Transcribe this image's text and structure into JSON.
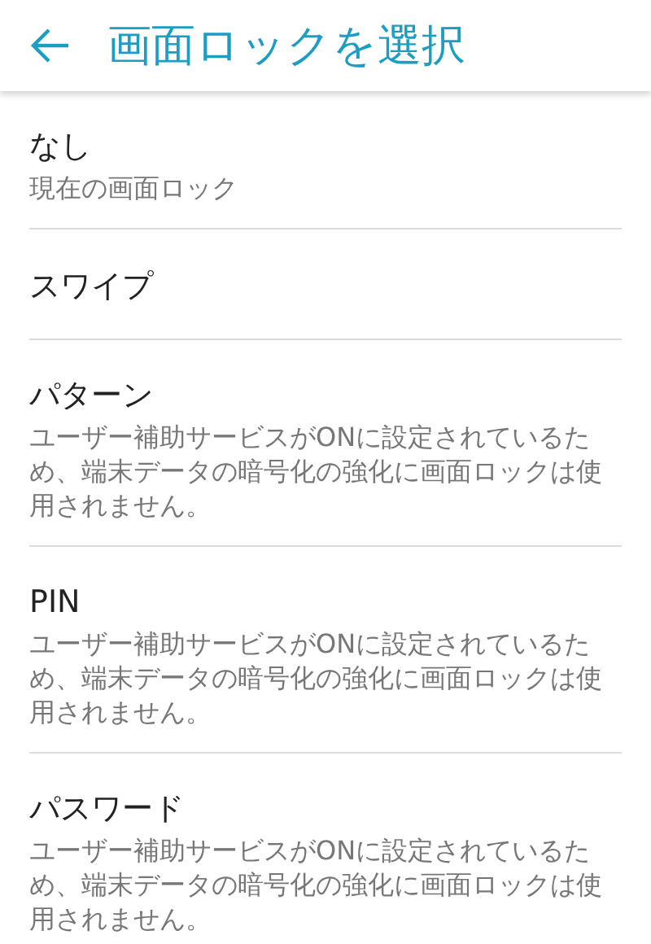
{
  "header": {
    "title": "画面ロックを選択"
  },
  "options": [
    {
      "title": "なし",
      "description": "現在の画面ロック"
    },
    {
      "title": "スワイプ"
    },
    {
      "title": "パターン",
      "description": "ユーザー補助サービスがONに設定されているため、端末データの暗号化の強化に画面ロックは使用されません。"
    },
    {
      "title": "PIN",
      "description": "ユーザー補助サービスがONに設定されているため、端末データの暗号化の強化に画面ロックは使用されません。"
    },
    {
      "title": "パスワード",
      "description": "ユーザー補助サービスがONに設定されているため、端末データの暗号化の強化に画面ロックは使用されません。"
    }
  ]
}
